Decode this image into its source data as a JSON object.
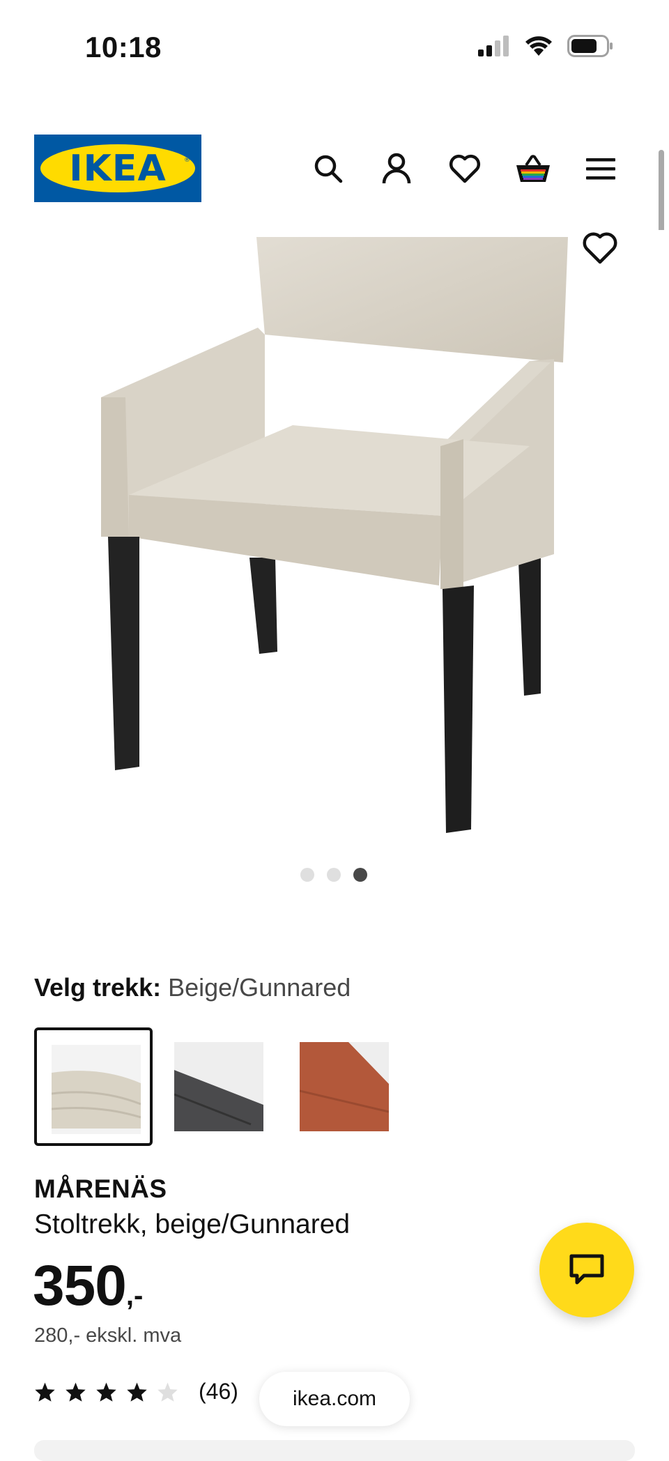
{
  "status_bar": {
    "time": "10:18",
    "icons": [
      "cellular-signal-icon",
      "wifi-icon",
      "battery-icon"
    ]
  },
  "header": {
    "logo_text": "IKEA",
    "icons": [
      "search-icon",
      "profile-icon",
      "heart-icon",
      "shopping-bag-icon",
      "menu-icon"
    ]
  },
  "gallery": {
    "image_count": 3,
    "active_index": 2
  },
  "variant": {
    "label": "Velg trekk:",
    "value": "Beige/Gunnared",
    "options": [
      {
        "name": "Beige/Gunnared",
        "color": "#d8d2c4",
        "selected": true
      },
      {
        "name": "Dark grey",
        "color": "#4b4b4d",
        "selected": false
      },
      {
        "name": "Rust",
        "color": "#b35a3c",
        "selected": false
      }
    ]
  },
  "product": {
    "name": "MÅRENÄS",
    "description": "Stoltrekk, beige/Gunnared",
    "price": "350",
    "price_suffix": ",-",
    "price_ex_vat": "280,- ekskl. mva",
    "rating": {
      "stars": 4,
      "max": 5,
      "count": "(46)"
    }
  },
  "browser": {
    "url": "ikea.com"
  },
  "colors": {
    "brand_blue": "#0058a3",
    "brand_yellow": "#ffdb00",
    "chat_yellow": "#ffda1a"
  }
}
